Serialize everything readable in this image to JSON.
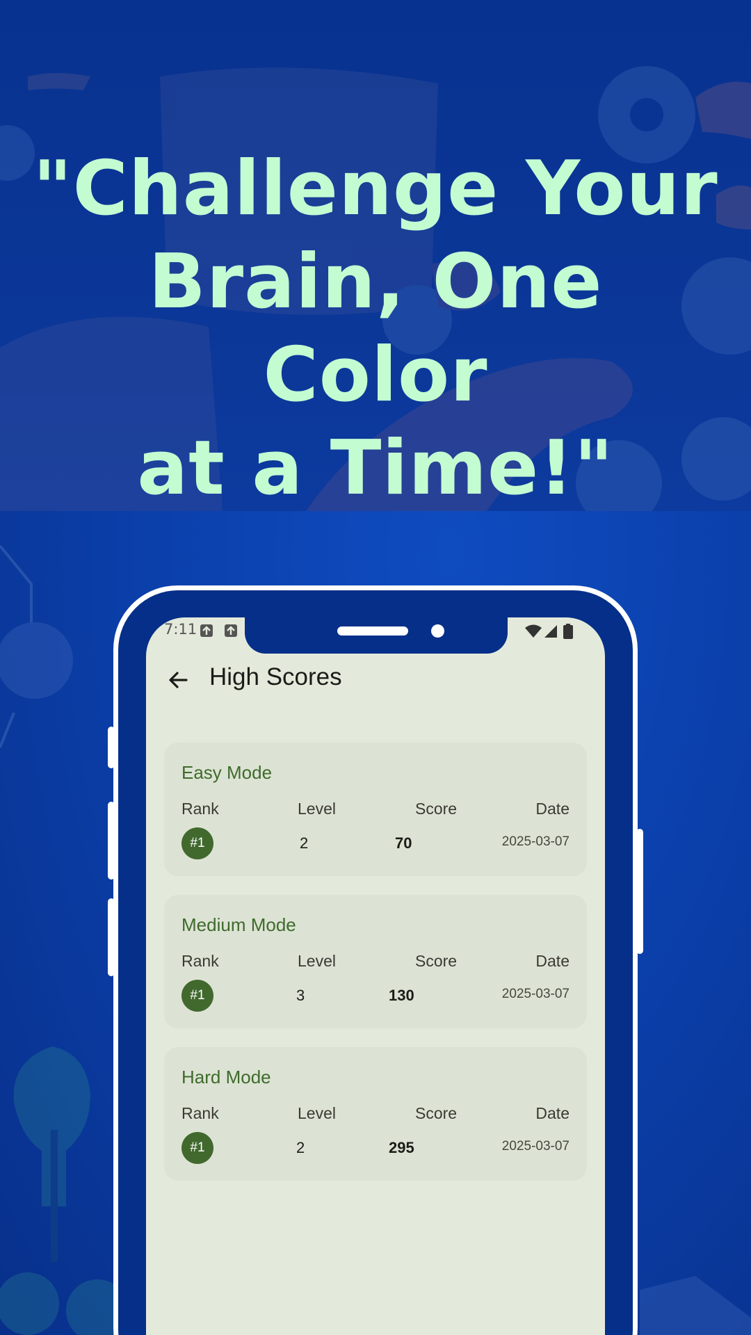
{
  "promo": {
    "headline_line1": "\"Challenge Your",
    "headline_line2": "Brain, One Color",
    "headline_line3": "at a Time!\""
  },
  "status_bar": {
    "time": "7:11",
    "left_icons": [
      "notification-icon",
      "notification-icon"
    ],
    "right_icons": [
      "wifi-icon",
      "signal-icon",
      "battery-icon"
    ]
  },
  "app_bar": {
    "back_icon": "arrow-back-icon",
    "title": "High Scores"
  },
  "columns": {
    "rank": "Rank",
    "level": "Level",
    "score": "Score",
    "date": "Date"
  },
  "modes": [
    {
      "title": "Easy Mode",
      "rank": "#1",
      "level": "2",
      "score": "70",
      "date": "2025-03-07"
    },
    {
      "title": "Medium Mode",
      "rank": "#1",
      "level": "3",
      "score": "130",
      "date": "2025-03-07"
    },
    {
      "title": "Hard Mode",
      "rank": "#1",
      "level": "2",
      "score": "295",
      "date": "2025-03-07"
    }
  ],
  "colors": {
    "background_blue": "#0b3aa3",
    "headline_mint": "#c4fcd2",
    "accent_green": "#41692e",
    "screen_bg": "#e4eadb",
    "card_bg": "#dde3d4"
  }
}
